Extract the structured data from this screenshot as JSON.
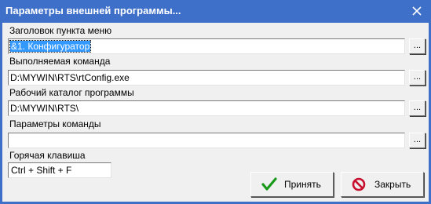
{
  "dialog": {
    "title": "Параметры внешней программы...",
    "close_label": "✕"
  },
  "fields": [
    {
      "label": "Заголовок пункта меню",
      "value": "&1. Конфигуратор",
      "browse_label": "..."
    },
    {
      "label": "Выполняемая команда",
      "value": "D:\\MYWIN\\RTS\\rtConfig.exe",
      "browse_label": "..."
    },
    {
      "label": "Рабочий каталог программы",
      "value": "D:\\MYWIN\\RTS\\",
      "browse_label": "..."
    },
    {
      "label": "Параметры команды",
      "value": "",
      "browse_label": "..."
    }
  ],
  "hotkey": {
    "label": "Горячая клавиша",
    "value": "Ctrl + Shift + F"
  },
  "buttons": {
    "ok_label": "Принять",
    "close_label": "Закрыть"
  },
  "colors": {
    "titlebar": "#3e6fc9",
    "selection": "#3399ff",
    "ok_icon": "#1a9a1a",
    "close_icon": "#c8102e"
  },
  "icons": {
    "ok": "check-icon",
    "close": "no-entry-icon",
    "window_close": "close-icon"
  }
}
